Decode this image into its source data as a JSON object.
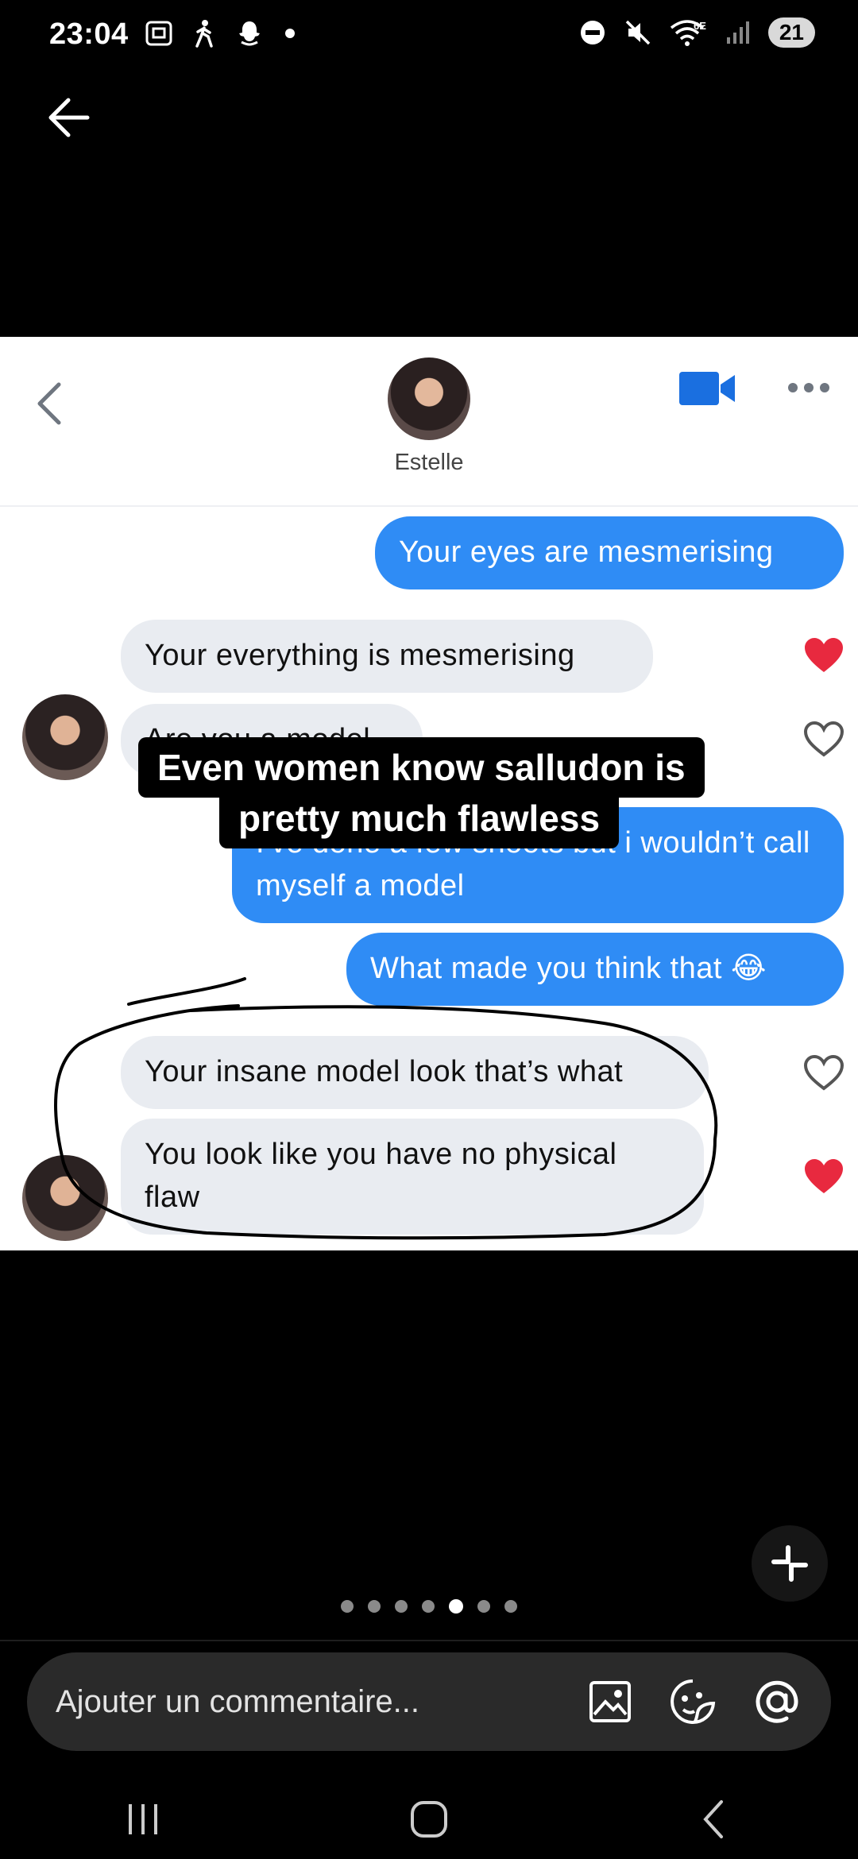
{
  "status_bar": {
    "time": "23:04",
    "battery": "21",
    "network": "6E",
    "left_icons": [
      "screenshot-icon",
      "walking-icon",
      "snapchat-icon",
      "dot-icon"
    ],
    "right_icons": [
      "dnd-icon",
      "mute-icon",
      "wifi-icon",
      "signal-icon"
    ]
  },
  "chat": {
    "contact_name": "Estelle",
    "messages": [
      {
        "direction": "out",
        "text": "Your eyes are mesmerising"
      },
      {
        "direction": "in",
        "text": "Your everything is mesmerising",
        "liked": true
      },
      {
        "direction": "in",
        "text": "Are you a model",
        "liked": false
      },
      {
        "direction": "out",
        "text": "I've done a few shoots but i wouldn’t call myself a model"
      },
      {
        "direction": "out",
        "text": "What made you think that 😂"
      },
      {
        "direction": "in",
        "text": "Your insane model look that’s what",
        "liked": false
      },
      {
        "direction": "in",
        "text": "You look like you have no physical flaw",
        "liked": true
      }
    ]
  },
  "caption": {
    "line1": "Even women know salludon is",
    "line2": "pretty much flawless"
  },
  "carousel": {
    "count": 7,
    "active_index": 4
  },
  "comment": {
    "placeholder": "Ajouter un commentaire..."
  },
  "colors": {
    "bubble_out": "#2f8cf5",
    "bubble_in": "#e9ecf1",
    "heart_liked": "#e8293f"
  }
}
